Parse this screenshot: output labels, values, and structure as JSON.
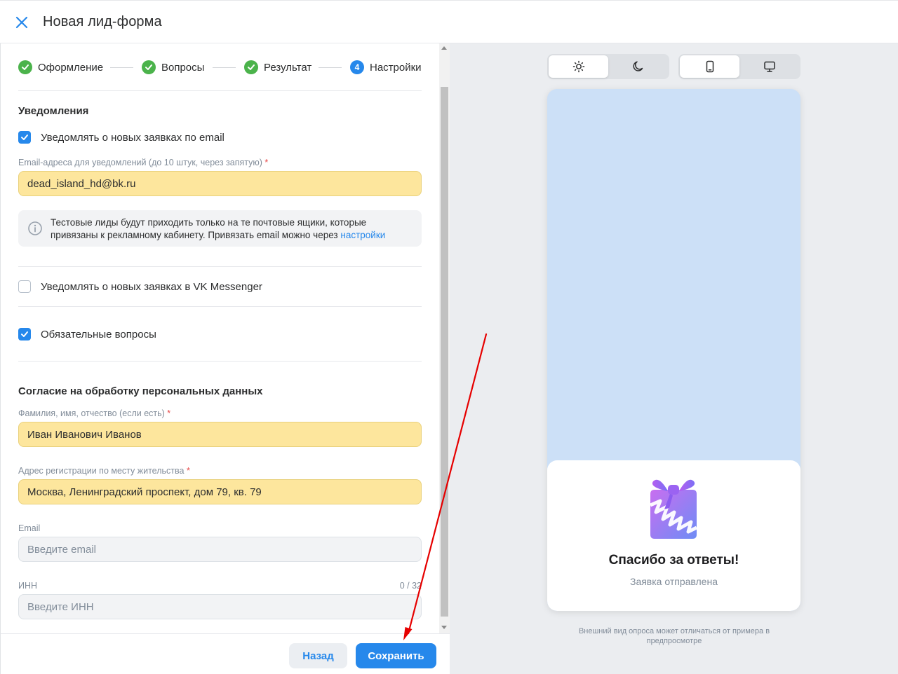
{
  "header": {
    "title": "Новая лид-форма"
  },
  "steps": [
    {
      "label": "Оформление",
      "state": "done"
    },
    {
      "label": "Вопросы",
      "state": "done"
    },
    {
      "label": "Результат",
      "state": "done"
    },
    {
      "label": "Настройки",
      "state": "current",
      "number": "4"
    }
  ],
  "notifications": {
    "title": "Уведомления",
    "email_checkbox": {
      "label": "Уведомлять о новых заявках по email",
      "checked": true
    },
    "email_field": {
      "label": "Email-адреса для уведомлений (до 10 штук, через запятую)",
      "required_mark": "*",
      "value": "dead_island_hd@bk.ru"
    },
    "info": {
      "text": "Тестовые лиды будут приходить только на те почтовые ящики, которые привязаны к рекламному кабинету. Привязать email можно через",
      "link": "настройки"
    },
    "vk_checkbox": {
      "label": "Уведомлять о новых заявках в VK Messenger",
      "checked": false
    },
    "required_checkbox": {
      "label": "Обязательные вопросы",
      "checked": true
    }
  },
  "consent": {
    "title": "Согласие на обработку персональных данных",
    "name_field": {
      "label": "Фамилия, имя, отчество (если есть)",
      "required_mark": "*",
      "value": "Иван Иванович Иванов"
    },
    "address_field": {
      "label": "Адрес регистрации по месту жительства",
      "required_mark": "*",
      "value": "Москва, Ленинградский проспект, дом 79, кв. 79"
    },
    "email_field": {
      "label": "Email",
      "placeholder": "Введите email"
    },
    "inn_field": {
      "label": "ИНН",
      "counter": "0 / 32",
      "placeholder": "Введите ИНН"
    }
  },
  "footer": {
    "back_label": "Назад",
    "save_label": "Сохранить"
  },
  "preview": {
    "theme_toggle": {
      "options": [
        "sun-icon",
        "moon-icon"
      ],
      "active": "light"
    },
    "device_toggle": {
      "options": [
        "phone-icon",
        "monitor-icon"
      ],
      "active": "phone"
    },
    "card_title": "Спасибо за ответы!",
    "card_subtitle": "Заявка отправлена",
    "note": "Внешний вид опроса может отличаться от примера в предпросмотре"
  },
  "colors": {
    "accent": "#2688eb",
    "done": "#4bb34b",
    "filled_input": "#fde69d",
    "annotation_arrow": "#e60000"
  }
}
